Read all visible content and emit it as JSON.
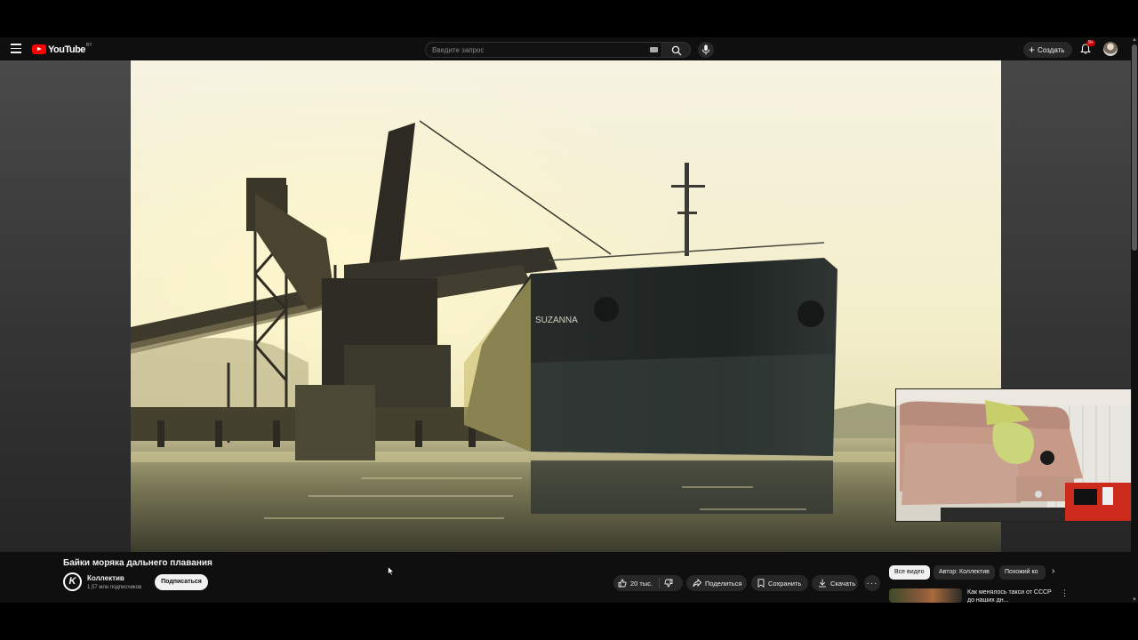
{
  "masthead": {
    "logo_text": "YouTube",
    "logo_country": "BY",
    "search_placeholder": "Введите запрос",
    "create_label": "Создать",
    "notifications_badge": "9+"
  },
  "video": {
    "title": "Байки моряка дальнего плавания",
    "ship_name": "SUZANNA",
    "watermark_letter": "K"
  },
  "channel": {
    "avatar_letter": "K",
    "name": "Коллектив",
    "subscribers": "1,57 млн подписчиков",
    "subscribe_label": "Подписаться"
  },
  "actions": {
    "like_count": "20 тыс.",
    "share_label": "Поделиться",
    "save_label": "Сохранить",
    "download_label": "Скачать",
    "more_label": "···"
  },
  "chips": [
    {
      "label": "Все видео",
      "active": true
    },
    {
      "label": "Автор: Коллектив",
      "active": false
    },
    {
      "label": "Похожий ко",
      "active": false
    }
  ],
  "recommendation": {
    "title": "Как менялось такси от СССР до наших дн..."
  },
  "colors": {
    "brand_red": "#ff0000",
    "background": "#0f0f0f",
    "pill": "#272727"
  }
}
